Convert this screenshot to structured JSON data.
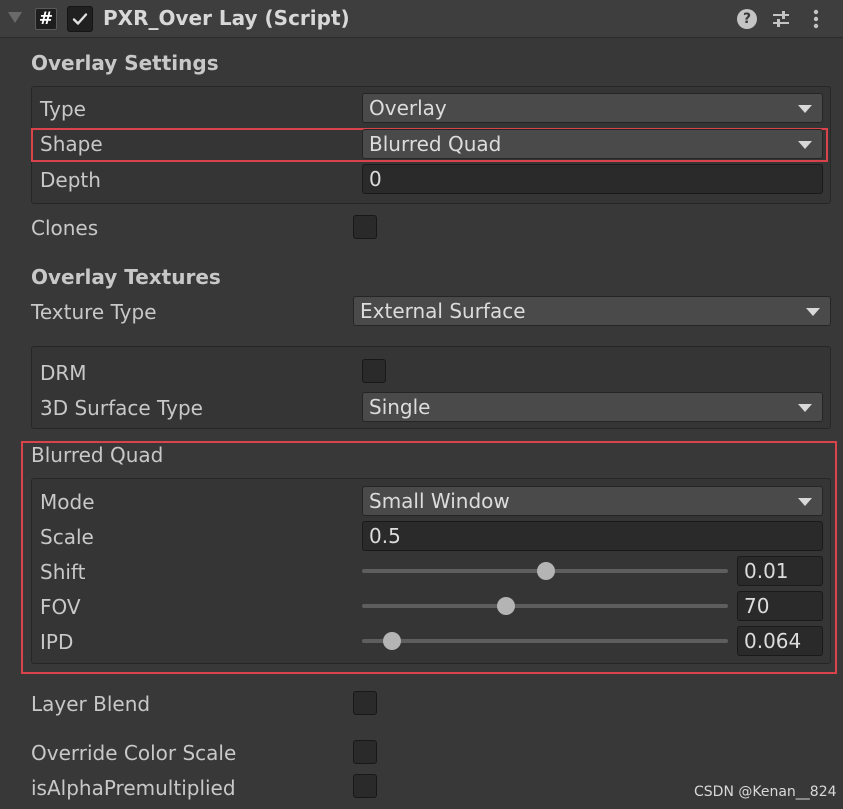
{
  "header": {
    "script_icon_glyph": "#",
    "title": "PXR_Over Lay (Script)",
    "enabled": true,
    "help_glyph": "?",
    "icons": [
      "foldout-arrow-icon",
      "script-icon",
      "help-icon",
      "presets-icon",
      "kebab-menu-icon"
    ]
  },
  "overlay_settings": {
    "heading": "Overlay Settings",
    "type_label": "Type",
    "type_value": "Overlay",
    "shape_label": "Shape",
    "shape_value": "Blurred Quad",
    "depth_label": "Depth",
    "depth_value": "0"
  },
  "clones": {
    "label": "Clones",
    "checked": false
  },
  "overlay_textures": {
    "heading": "Overlay Textures",
    "texture_type_label": "Texture Type",
    "texture_type_value": "External Surface",
    "drm_label": "DRM",
    "drm_checked": false,
    "surface_type_label": "3D Surface Type",
    "surface_type_value": "Single"
  },
  "blurred_quad": {
    "heading": "Blurred Quad",
    "mode_label": "Mode",
    "mode_value": "Small Window",
    "scale_label": "Scale",
    "scale_value": "0.5",
    "shift_label": "Shift",
    "shift_value": "0.01",
    "shift_fraction": 0.5,
    "fov_label": "FOV",
    "fov_value": "70",
    "fov_fraction": 0.39,
    "ipd_label": "IPD",
    "ipd_value": "0.064",
    "ipd_fraction": 0.08
  },
  "layer_blend": {
    "label": "Layer Blend",
    "checked": false
  },
  "override_color_scale": {
    "label": "Override Color Scale",
    "checked": false
  },
  "is_alpha_premultiplied": {
    "label": "isAlphaPremultiplied",
    "checked": false
  },
  "watermark": "CSDN @Kenan__824",
  "colors": {
    "background": "#383838",
    "highlight": "#d9434a",
    "field": "#2a2a2a",
    "dropdown": "#4a4a4a"
  }
}
